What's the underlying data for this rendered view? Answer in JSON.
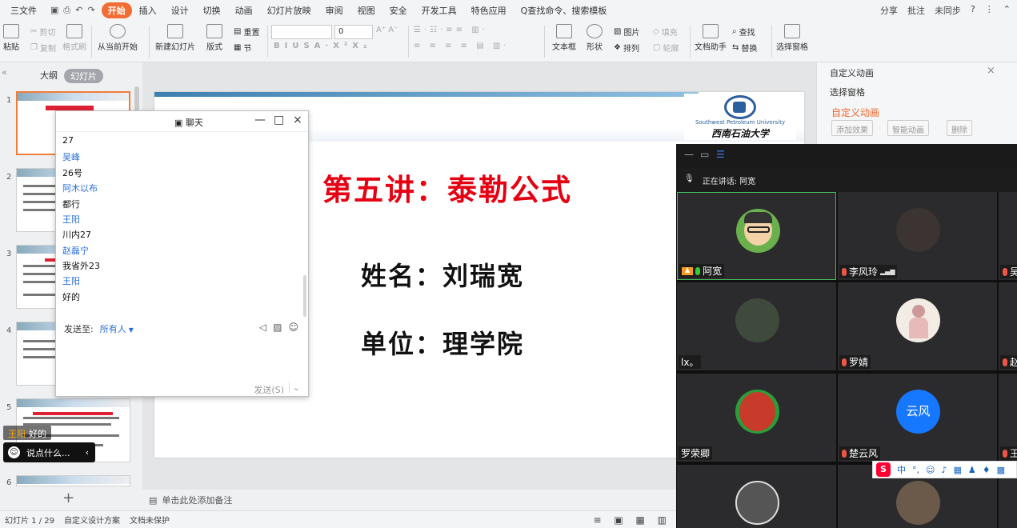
{
  "menubar": {
    "file": "三文件",
    "tabs": [
      "开始",
      "插入",
      "设计",
      "切换",
      "动画",
      "幻灯片放映",
      "审阅",
      "视图",
      "安全",
      "开发工具",
      "特色应用"
    ],
    "search": "Q查找命令、搜索模板",
    "share": "分享",
    "comment": "批注",
    "sync": "未同步"
  },
  "ribbon": {
    "paste": "粘贴",
    "cut": "剪切",
    "copy": "复制",
    "format_painter": "格式刷",
    "play_from_current": "从当前开始",
    "new_slide": "新建幻灯片",
    "layout": "版式",
    "reset": "重置",
    "section": "节",
    "font_size": "0",
    "textbox": "文本框",
    "shape": "形状",
    "arrange": "排列",
    "picture": "图片",
    "fill": "填充",
    "outline": "轮廓",
    "doc_helper": "文档助手",
    "find": "查找",
    "replace": "替换",
    "select_pane": "选择窗格"
  },
  "left_panel": {
    "tab_outline": "大纲",
    "tab_slides": "幻灯片",
    "numbers": [
      "1",
      "2",
      "3",
      "4",
      "5",
      "6"
    ]
  },
  "slide": {
    "title": "第五讲：泰勒公式",
    "name_line": "姓名：刘瑞宽",
    "unit_line": "单位：理学院",
    "university_en": "Southwest Petroleum University",
    "university_cn": "西南石油大学"
  },
  "notes_placeholder": "单击此处添加备注",
  "right_pane": {
    "header": "自定义动画",
    "select_pane": "选择窗格",
    "section": "自定义动画",
    "add_effect": "添加效果",
    "smart_anim": "智能动画",
    "delete": "删除"
  },
  "status": {
    "slide_info": "幻灯片 1 / 29",
    "theme": "自定义设计方案",
    "protect": "文档未保护"
  },
  "chat": {
    "title": "聊天",
    "messages": [
      {
        "type": "body",
        "text": "27"
      },
      {
        "type": "name",
        "text": "吴峰"
      },
      {
        "type": "body",
        "text": "26号"
      },
      {
        "type": "name",
        "text": "阿木以布"
      },
      {
        "type": "body",
        "text": "都行"
      },
      {
        "type": "name",
        "text": "王阳"
      },
      {
        "type": "body",
        "text": "川内27"
      },
      {
        "type": "name",
        "text": "赵磊宁"
      },
      {
        "type": "body",
        "text": "我省外23"
      },
      {
        "type": "name",
        "text": "王阳"
      },
      {
        "type": "body",
        "text": "好的"
      }
    ],
    "send_to_label": "发送至:",
    "send_to_value": "所有人",
    "send_button": "发送(S)"
  },
  "danmaku": {
    "user": "王阳",
    "text": "好的"
  },
  "say_placeholder": "说点什么...",
  "meeting": {
    "speaking": "正在讲话: 阿宽",
    "participants": [
      "阿宽",
      "李风玲",
      "吴",
      "lx。",
      "罗婧",
      "赵",
      "罗荣卿",
      "楚云风",
      "王"
    ],
    "avatar_text": "云风"
  },
  "ime": {
    "lang": "中"
  },
  "colors": {
    "accent": "#f26c34",
    "slide_title": "#e50012",
    "chat_name": "#2a6fd6",
    "active_speaker": "#41c05a"
  }
}
